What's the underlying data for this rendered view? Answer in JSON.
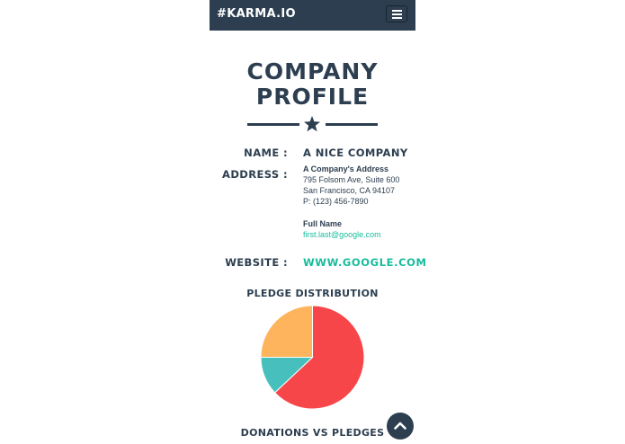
{
  "navbar": {
    "brand": "#KARMA.IO",
    "menu_icon": "hamburger-menu-icon"
  },
  "profile": {
    "title_line1": "COMPANY",
    "title_line2": "PROFILE",
    "divider_icon": "star-icon",
    "name_label": "NAME :",
    "name_value": "A NICE COMPANY",
    "address_label": "ADDRESS :",
    "address": {
      "heading": "A Company's Address",
      "line1": "795 Folsom Ave, Suite 600",
      "line2": "San Francisco, CA 94107",
      "phone": "P: (123) 456-7890"
    },
    "contact": {
      "name": "Full Name",
      "email": "first.last@google.com"
    },
    "website_label": "WEBSITE :",
    "website_value": "WWW.GOOGLE.COM"
  },
  "pledge_section": {
    "title": "PLEDGE DISTRIBUTION"
  },
  "chart_data": {
    "type": "pie",
    "title": "PLEDGE DISTRIBUTION",
    "values": [
      63,
      12,
      25
    ],
    "colors": [
      "#f7464a",
      "#46bfbd",
      "#fdb45c"
    ]
  },
  "donations_section": {
    "title": "DONATIONS VS PLEDGES"
  },
  "scroll_top": {
    "icon": "chevron-up-icon"
  },
  "colors": {
    "primary": "#2c3e50",
    "accent": "#18bc9c"
  }
}
